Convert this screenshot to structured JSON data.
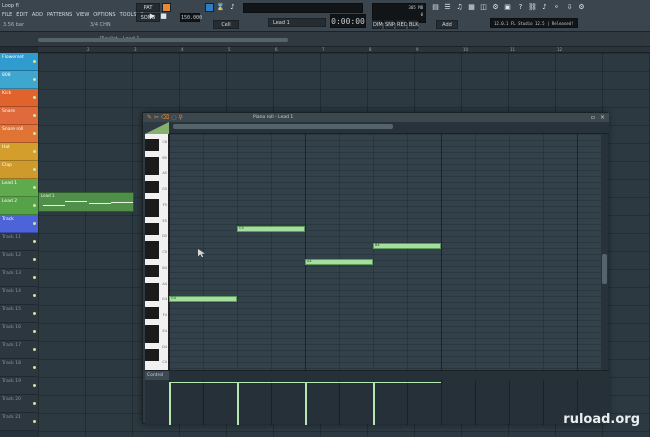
{
  "window": {
    "title": "Loop fl"
  },
  "menu": [
    "FILE",
    "EDIT",
    "ADD",
    "PATTERNS",
    "VIEW",
    "OPTIONS",
    "TOOLS",
    "?"
  ],
  "toolbar": {
    "pat_label": "PAT",
    "song_label": "SONG",
    "tempo": "150.000",
    "time_display": "0:00:00",
    "cpu": "305 MB",
    "cpu_sub": "0",
    "snap": "Cell",
    "pattern_name": "Lead 1",
    "add_label": "Add",
    "news": "12.0.1 FL Studio 12.5 | Released!",
    "mode_buttons": [
      "DIM",
      "SNP",
      "REC",
      "BLK"
    ],
    "small_left": "3.56 bar",
    "small_left2": "3/4 CHN"
  },
  "second_bar": {
    "playlist_label": "Playlist - Lead 1"
  },
  "ruler_ticks": [
    "2",
    "3",
    "4",
    "5",
    "6",
    "7",
    "8",
    "9",
    "10",
    "11",
    "12"
  ],
  "tracks": [
    {
      "name": "Flowerset",
      "color": "#2f9bcf"
    },
    {
      "name": "808",
      "color": "#3fa6cf"
    },
    {
      "name": "Kick",
      "color": "#e0622c"
    },
    {
      "name": "Snare",
      "color": "#e06a3c"
    },
    {
      "name": "Snare roll",
      "color": "#e07434"
    },
    {
      "name": "Hat",
      "color": "#d49e2d"
    },
    {
      "name": "Clap",
      "color": "#cf9a2c"
    },
    {
      "name": "Lead 1",
      "color": "#5faa4c"
    },
    {
      "name": "Lead 2",
      "color": "#55a248"
    },
    {
      "name": "Track",
      "color": "#4c63d9"
    },
    {
      "name": "Track 11",
      "color": "#2d3740"
    },
    {
      "name": "Track 12",
      "color": "#2d3740"
    },
    {
      "name": "Track 13",
      "color": "#2d3740"
    },
    {
      "name": "Track 14",
      "color": "#2d3740"
    },
    {
      "name": "Track 15",
      "color": "#2d3740"
    },
    {
      "name": "Track 16",
      "color": "#2d3740"
    },
    {
      "name": "Track 17",
      "color": "#2d3740"
    },
    {
      "name": "Track 18",
      "color": "#2d3740"
    },
    {
      "name": "Track 19",
      "color": "#2d3740"
    },
    {
      "name": "Track 20",
      "color": "#2d3740"
    },
    {
      "name": "Track 21",
      "color": "#2d3740"
    }
  ],
  "clip": {
    "label": "Lead 1"
  },
  "piano_roll": {
    "title": "Piano roll - Lead 1",
    "key_labels": [
      "C6",
      "B5",
      "A5",
      "G5",
      "F5",
      "E5",
      "D5",
      "C5",
      "B4",
      "A4",
      "G4",
      "F4",
      "E4",
      "D4",
      "C4"
    ],
    "notes": [
      {
        "label": "G4",
        "start": 0,
        "length": 2,
        "row": 0.685
      },
      {
        "label": "C5",
        "start": 2,
        "length": 2,
        "row": 0.39
      },
      {
        "label": "A4",
        "start": 4,
        "length": 2,
        "row": 0.53
      },
      {
        "label": "B4",
        "start": 6,
        "length": 2,
        "row": 0.46
      }
    ],
    "control_label": "Control",
    "velocities": [
      1,
      1,
      1,
      1
    ]
  },
  "watermark": "ruload.org"
}
